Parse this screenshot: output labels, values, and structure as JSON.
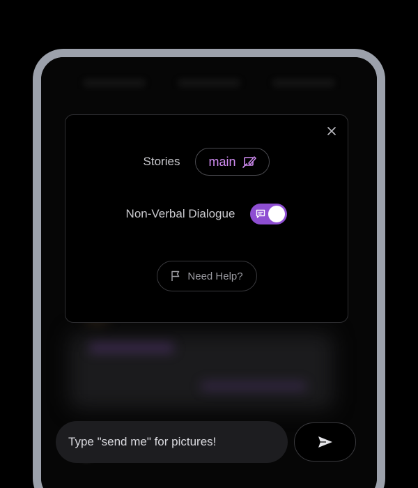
{
  "settings": {
    "stories_label": "Stories",
    "stories_value": "main",
    "nonverbal_label": "Non-Verbal Dialogue",
    "nonverbal_enabled": true,
    "help_label": "Need Help?"
  },
  "composer": {
    "placeholder": "Type \"send me\" for pictures!"
  },
  "icons": {
    "close": "close-icon",
    "stories_edit": "edit-story-icon",
    "toggle_chat": "chat-bubble-icon",
    "help_flag": "flag-icon",
    "send": "send-arrow-icon"
  },
  "colors": {
    "accent": "#8e4ed2",
    "accent_text": "#d08cf2",
    "frame": "#9ca1ab"
  }
}
